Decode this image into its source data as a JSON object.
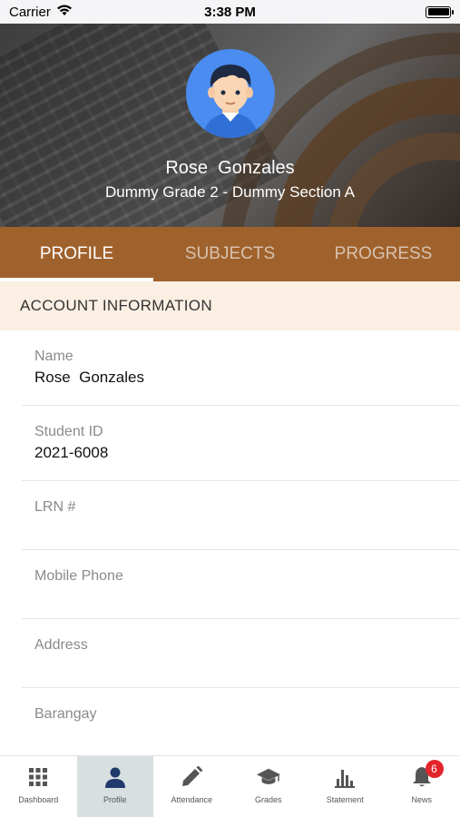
{
  "status_bar": {
    "carrier": "Carrier",
    "time": "3:38 PM"
  },
  "profile": {
    "name": "Rose  Gonzales",
    "grade_section": "Dummy Grade 2 - Dummy Section A"
  },
  "tabs": [
    {
      "label": "PROFILE",
      "active": true
    },
    {
      "label": "SUBJECTS",
      "active": false
    },
    {
      "label": "PROGRESS",
      "active": false
    }
  ],
  "section": {
    "title": "ACCOUNT INFORMATION"
  },
  "fields": [
    {
      "label": "Name",
      "value": "Rose  Gonzales"
    },
    {
      "label": "Student ID",
      "value": "2021-6008"
    },
    {
      "label": "LRN #",
      "value": ""
    },
    {
      "label": "Mobile Phone",
      "value": ""
    },
    {
      "label": "Address",
      "value": ""
    },
    {
      "label": "Barangay",
      "value": ""
    }
  ],
  "bottom_nav": [
    {
      "label": "Dashboard",
      "icon": "grid-icon"
    },
    {
      "label": "Profile",
      "icon": "person-icon",
      "active": true
    },
    {
      "label": "Attendance",
      "icon": "pencil-icon"
    },
    {
      "label": "Grades",
      "icon": "graduation-cap-icon"
    },
    {
      "label": "Statement",
      "icon": "bar-chart-icon"
    },
    {
      "label": "News",
      "icon": "bell-icon",
      "badge": "6"
    }
  ],
  "colors": {
    "accent": "#a0622c",
    "section_bg": "#fbefe3",
    "active_nav": "#d7dfe0",
    "badge": "#e3242b"
  }
}
